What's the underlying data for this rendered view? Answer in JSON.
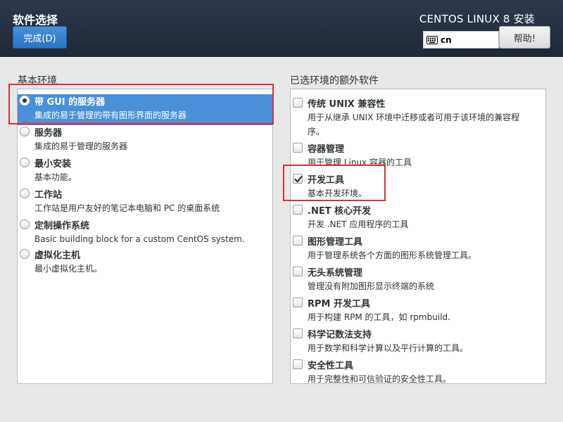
{
  "header": {
    "title": "软件选择",
    "done_label": "完成(D)",
    "installer_title": "CENTOS LINUX 8 安装",
    "keyboard_layout": "cn",
    "help_label": "帮助!"
  },
  "base_environment": {
    "label": "基本环境",
    "selected_index": 0,
    "items": [
      {
        "name": "带 GUI 的服务器",
        "desc": "集成的易于管理的带有图形界面的服务器"
      },
      {
        "name": "服务器",
        "desc": "集成的易于管理的服务器"
      },
      {
        "name": "最小安装",
        "desc": "基本功能。"
      },
      {
        "name": "工作站",
        "desc": "工作站是用户友好的笔记本电脑和 PC 的桌面系统"
      },
      {
        "name": "定制操作系统",
        "desc": "Basic building block for a custom CentOS system."
      },
      {
        "name": "虚拟化主机",
        "desc": "最小虚拟化主机。"
      }
    ]
  },
  "addons": {
    "label": "已选环境的额外软件",
    "items": [
      {
        "name": "传统 UNIX 兼容性",
        "desc_line1": "用于从继承 UNIX 环境中迁移或者可用于该环境的兼容程",
        "desc_line2": "序。",
        "checked": false
      },
      {
        "name": "容器管理",
        "desc_line1": "用于管理 Linux 容器的工具",
        "checked": false
      },
      {
        "name": "开发工具",
        "desc_line1": "基本开发环境。",
        "checked": true
      },
      {
        "name": ".NET 核心开发",
        "desc_line1": "开发 .NET 应用程序的工具",
        "checked": false
      },
      {
        "name": "图形管理工具",
        "desc_line1": "用于管理系统各个方面的图形系统管理工具。",
        "checked": false
      },
      {
        "name": "无头系统管理",
        "desc_line1": "管理没有附加图形显示终端的系统",
        "checked": false
      },
      {
        "name": "RPM 开发工具",
        "desc_line1": "用于构建 RPM 的工具，如 rpmbuild.",
        "checked": false
      },
      {
        "name": "科学记数法支持",
        "desc_line1": "用于数学和科学计算以及平行计算的工具。",
        "checked": false
      },
      {
        "name": "安全性工具",
        "desc_line1": "用于完整性和可信验证的安全性工具。",
        "checked": false
      }
    ]
  },
  "icons": {
    "keyboard": "keyboard-icon",
    "check": "checkmark-icon"
  },
  "colors": {
    "header_bg": "#2d3a4b",
    "accent_blue": "#4a90d9",
    "highlight_red": "#d9303b"
  }
}
